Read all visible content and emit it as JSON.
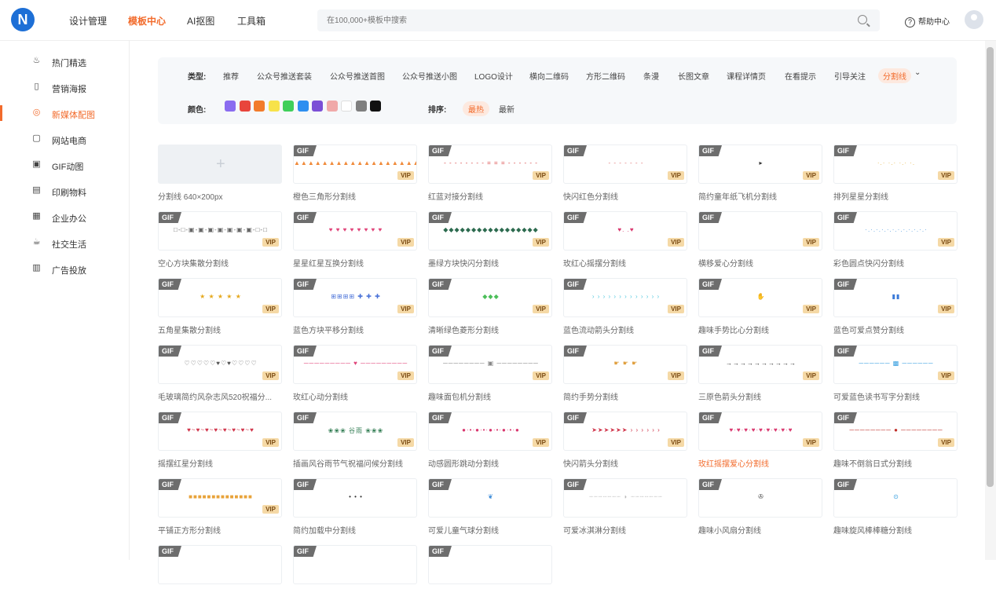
{
  "topbar": {
    "logo_text": "N",
    "nav": [
      "设计管理",
      "模板中心",
      "AI抠图",
      "工具箱"
    ],
    "active_nav": 1,
    "search_placeholder": "在100,000+模板中搜索",
    "help_label": "帮助中心"
  },
  "sidebar": {
    "active": 2,
    "items": [
      {
        "label": "热门精选",
        "icon": "flame-icon",
        "glyph": "♨"
      },
      {
        "label": "营销海报",
        "icon": "poster-icon",
        "glyph": "▯"
      },
      {
        "label": "新媒体配图",
        "icon": "chat-icon",
        "glyph": "◎"
      },
      {
        "label": "网站电商",
        "icon": "shop-icon",
        "glyph": "▢"
      },
      {
        "label": "GIF动图",
        "icon": "gif-icon",
        "glyph": "▣"
      },
      {
        "label": "印刷物料",
        "icon": "print-icon",
        "glyph": "▤"
      },
      {
        "label": "企业办公",
        "icon": "office-icon",
        "glyph": "▦"
      },
      {
        "label": "社交生活",
        "icon": "cup-icon",
        "glyph": "☕"
      },
      {
        "label": "广告投放",
        "icon": "ad-icon",
        "glyph": "▥"
      }
    ]
  },
  "filter": {
    "type_label": "类型:",
    "types": [
      "推荐",
      "公众号推送套装",
      "公众号推送首图",
      "公众号推送小图",
      "LOGO设计",
      "横向二维码",
      "方形二维码",
      "条漫",
      "长图文章",
      "课程详情页",
      "在看提示",
      "引导关注",
      "分割线"
    ],
    "active_type": 12,
    "more_glyph": "⌄",
    "color_label": "颜色:",
    "colors": [
      "#8a6cf0",
      "#e8453c",
      "#f27b2b",
      "#f7e24a",
      "#3fcf5a",
      "#2e8ff0",
      "#7b4fd6",
      "#f0a9a9",
      "#ffffff",
      "#7f7f7f",
      "#111111"
    ],
    "sort_label": "排序:",
    "sorts": [
      "最热",
      "最新"
    ],
    "active_sort": 0
  },
  "cards": [
    {
      "title": "分割线 640×200px",
      "blank": true,
      "deco": "",
      "deco_color": "#999",
      "vip": false,
      "gif": false
    },
    {
      "title": "橙色三角形分割线",
      "deco": "▲▲▲▲▲▲▲▲▲▲▲▲▲▲▲▲▲▲",
      "deco_color": "#f08a3a",
      "vip": true,
      "gif": true
    },
    {
      "title": "红蓝对接分割线",
      "deco": "- - - - - - - - = = = - - - - - -",
      "deco_color": "#d83a3a",
      "vip": true,
      "gif": true
    },
    {
      "title": "快闪红色分割线",
      "deco": "- - - - - - -",
      "deco_color": "#e07070",
      "vip": true,
      "gif": true
    },
    {
      "title": "简约童年纸飞机分割线",
      "deco": "▸",
      "deco_color": "#333",
      "vip": true,
      "gif": true
    },
    {
      "title": "排列星星分割线",
      "deco": "·.·  ·.·  ·.·  ·.",
      "deco_color": "#e6b84a",
      "vip": true,
      "gif": true
    },
    {
      "title": "空心方块集散分割线",
      "deco": "□-□-▣-▣-▣-▣-▣-▣-▣-□-□",
      "deco_color": "#666",
      "vip": true,
      "gif": true
    },
    {
      "title": "星星红星互换分割线",
      "deco": "♥  ♥  ♥  ♥  ♥  ♥  ♥  ♥",
      "deco_color": "#e0457a",
      "vip": true,
      "gif": true
    },
    {
      "title": "墨绿方块快闪分割线",
      "deco": "◆◆◆◆◆◆◆◆◆◆◆◆◆◆◆◆◆",
      "deco_color": "#2d6b4f",
      "vip": true,
      "gif": true
    },
    {
      "title": "玫红心摇摆分割线",
      "deco": "♥.                        .♥",
      "deco_color": "#d9376e",
      "vip": true,
      "gif": true
    },
    {
      "title": "横移爱心分割线",
      "deco": "",
      "deco_color": "#d9376e",
      "vip": true,
      "gif": true
    },
    {
      "title": "彩色圆点快闪分割线",
      "deco": "·.·.·.·.·.·.·.·.·.·.·.·",
      "deco_color": "#5aa0e0",
      "vip": true,
      "gif": true
    },
    {
      "title": "五角星集散分割线",
      "deco": "★ ★ ★ ★ ★",
      "deco_color": "#e6a91f",
      "vip": true,
      "gif": true
    },
    {
      "title": "蓝色方块平移分割线",
      "deco": "⊞⊞⊞⊞ ✚  ✚     ✚",
      "deco_color": "#4a72d8",
      "vip": true,
      "gif": true
    },
    {
      "title": "清晰绿色菱形分割线",
      "deco": "◆◆◆",
      "deco_color": "#4cbf5a",
      "vip": true,
      "gif": true
    },
    {
      "title": "蓝色流动箭头分割线",
      "deco": "› › › › › › › › › › › › ›",
      "deco_color": "#5ccbe0",
      "vip": true,
      "gif": true
    },
    {
      "title": "趣味手势比心分割线",
      "deco": "✋",
      "deco_color": "#f0a070",
      "vip": true,
      "gif": true
    },
    {
      "title": "蓝色可爱点赞分割线",
      "deco": "▮▮",
      "deco_color": "#3a7ad8",
      "vip": true,
      "gif": true
    },
    {
      "title": "毛玻璃简约风杂志风520祝福分...",
      "deco": "♡♡♡♡♡♥♡♥♡♡♡♡",
      "deco_color": "#555",
      "vip": true,
      "gif": true
    },
    {
      "title": "玫红心动分割线",
      "deco": "───────── ♥ ─────────",
      "deco_color": "#e0457a",
      "vip": true,
      "gif": true
    },
    {
      "title": "趣味面包机分割线",
      "deco": "──────── ▣ ────────",
      "deco_color": "#888",
      "vip": true,
      "gif": true
    },
    {
      "title": "简约手势分割线",
      "deco": "☛        ☛        ☛",
      "deco_color": "#e0a040",
      "vip": true,
      "gif": true
    },
    {
      "title": "三原色箭头分割线",
      "deco": "→→→→→→→→→→",
      "deco_color": "#333",
      "vip": true,
      "gif": true
    },
    {
      "title": "可爱蓝色读书写字分割线",
      "deco": "────── ▩ ──────",
      "deco_color": "#3aa0e0",
      "vip": true,
      "gif": true
    },
    {
      "title": "摇摆红星分割线",
      "deco": "♥~♥~♥~♥~♥~♥~♥~♥",
      "deco_color": "#d0344a",
      "vip": true,
      "gif": true
    },
    {
      "title": "插画风谷雨节气祝福问候分割线",
      "deco": "❀❀❀ 谷雨 ❀❀❀",
      "deco_color": "#2d7a4f",
      "vip": true,
      "gif": true
    },
    {
      "title": "动感圆形跳动分割线",
      "deco": "●·•·●·•·●·•·●·•·●",
      "deco_color": "#d9376e",
      "vip": true,
      "gif": true
    },
    {
      "title": "快闪箭头分割线",
      "deco": "➤➤➤➤➤➤ › › › › › ›",
      "deco_color": "#d0344a",
      "vip": true,
      "gif": true
    },
    {
      "title": "玫红摇摆爱心分割线",
      "deco": "♥·♥·♥·♥·♥·♥·♥·♥·♥",
      "deco_color": "#d9376e",
      "vip": true,
      "gif": true,
      "highlight": true
    },
    {
      "title": "趣味不倒翁日式分割线",
      "deco": "──────── ● ────────",
      "deco_color": "#c0302a",
      "vip": true,
      "gif": true
    },
    {
      "title": "平铺正方形分割线",
      "deco": "■■■■■■■■■■■■■■",
      "deco_color": "#e8a33a",
      "vip": true,
      "gif": true
    },
    {
      "title": "简约加载中分割线",
      "deco": "• • •",
      "deco_color": "#333",
      "vip": false,
      "gif": true
    },
    {
      "title": "可爱儿童气球分割线",
      "deco": "❦",
      "deco_color": "#3a8ad8",
      "vip": false,
      "gif": true
    },
    {
      "title": "可爱冰淇淋分割线",
      "deco": "┄┄┄┄┄┄┄ ◗ ┄┄┄┄┄┄┄",
      "deco_color": "#bbb",
      "vip": false,
      "gif": true
    },
    {
      "title": "趣味小风扇分割线",
      "deco": "✇",
      "deco_color": "#444",
      "vip": false,
      "gif": true
    },
    {
      "title": "趣味旋风棒棒糖分割线",
      "deco": "⊙",
      "deco_color": "#3aa0e0",
      "vip": false,
      "gif": true
    },
    {
      "title": "",
      "deco": "",
      "deco_color": "#333",
      "vip": false,
      "gif": true
    },
    {
      "title": "",
      "deco": "",
      "deco_color": "#333",
      "vip": false,
      "gif": true
    },
    {
      "title": "",
      "deco": "",
      "deco_color": "#333",
      "vip": false,
      "gif": true
    }
  ],
  "labels": {
    "gif": "GIF",
    "vip": "VIP",
    "plus": "+"
  }
}
